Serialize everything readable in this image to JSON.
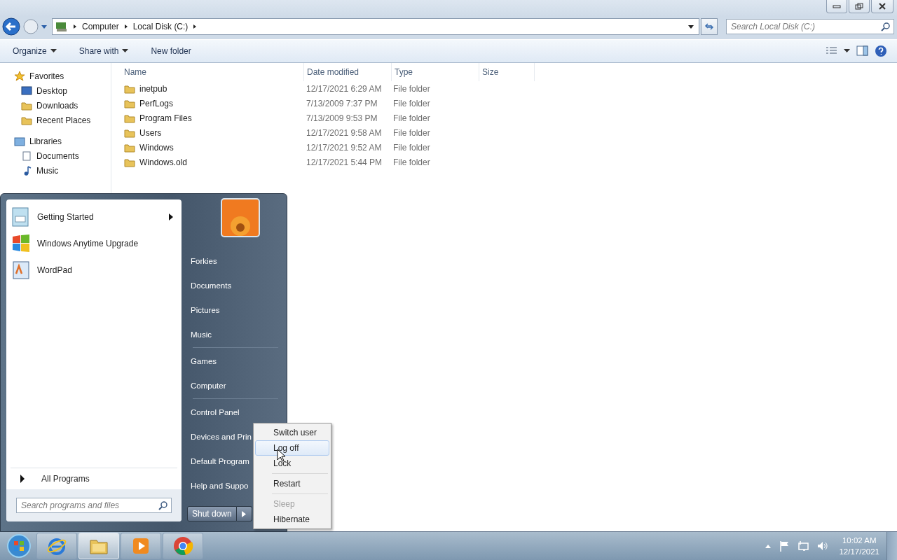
{
  "address": {
    "crumbs": [
      "Computer",
      "Local Disk (C:)"
    ]
  },
  "search": {
    "placeholder": "Search Local Disk (C:)"
  },
  "toolbar": [
    {
      "label": "Organize",
      "dropdown": true
    },
    {
      "label": "Share with",
      "dropdown": true
    },
    {
      "label": "New folder",
      "dropdown": false
    }
  ],
  "sidebar": [
    {
      "label": "Favorites",
      "kind": "star",
      "children": [
        {
          "label": "Desktop",
          "kind": "desktop"
        },
        {
          "label": "Downloads",
          "kind": "folder"
        },
        {
          "label": "Recent Places",
          "kind": "folder"
        }
      ]
    },
    {
      "label": "Libraries",
      "kind": "library",
      "children": [
        {
          "label": "Documents",
          "kind": "doc"
        },
        {
          "label": "Music",
          "kind": "music"
        }
      ]
    }
  ],
  "columns": [
    "Name",
    "Date modified",
    "Type",
    "Size"
  ],
  "rows": [
    {
      "name": "inetpub",
      "date": "12/17/2021 6:29 AM",
      "type": "File folder"
    },
    {
      "name": "PerfLogs",
      "date": "7/13/2009 7:37 PM",
      "type": "File folder"
    },
    {
      "name": "Program Files",
      "date": "7/13/2009 9:53 PM",
      "type": "File folder"
    },
    {
      "name": "Users",
      "date": "12/17/2021 9:58 AM",
      "type": "File folder"
    },
    {
      "name": "Windows",
      "date": "12/17/2021 9:52 AM",
      "type": "File folder"
    },
    {
      "name": "Windows.old",
      "date": "12/17/2021 5:44 PM",
      "type": "File folder"
    }
  ],
  "start_menu": {
    "programs": [
      {
        "label": "Getting Started",
        "kind": "getting-started",
        "submenu": true
      },
      {
        "label": "Windows Anytime Upgrade",
        "kind": "upgrade",
        "submenu": false
      },
      {
        "label": "WordPad",
        "kind": "wordpad",
        "submenu": false
      }
    ],
    "all_programs": "All Programs",
    "search": {
      "placeholder": "Search programs and files"
    },
    "links": [
      {
        "label": "Forkies",
        "divider_before": false
      },
      {
        "label": "Documents",
        "divider_before": false
      },
      {
        "label": "Pictures",
        "divider_before": false
      },
      {
        "label": "Music",
        "divider_before": false
      },
      {
        "label": "Games",
        "divider_before": true
      },
      {
        "label": "Computer",
        "divider_before": false
      },
      {
        "label": "Control Panel",
        "divider_before": true
      },
      {
        "label": "Devices and Prin",
        "divider_before": false
      },
      {
        "label": "Default Program",
        "divider_before": false
      },
      {
        "label": "Help and Suppo",
        "divider_before": false
      }
    ],
    "shutdown": "Shut down"
  },
  "power_menu": [
    {
      "label": "Switch user",
      "selected": false,
      "disabled": false,
      "divider_before": false
    },
    {
      "label": "Log off",
      "selected": true,
      "disabled": false,
      "divider_before": false
    },
    {
      "label": "Lock",
      "selected": false,
      "disabled": false,
      "divider_before": false
    },
    {
      "label": "Restart",
      "selected": false,
      "disabled": false,
      "divider_before": true
    },
    {
      "label": "Sleep",
      "selected": false,
      "disabled": true,
      "divider_before": true
    },
    {
      "label": "Hibernate",
      "selected": false,
      "disabled": false,
      "divider_before": false
    }
  ],
  "taskbar": {
    "apps": [
      {
        "kind": "ie",
        "selected": false
      },
      {
        "kind": "explorer",
        "selected": true
      },
      {
        "kind": "media",
        "selected": false
      },
      {
        "kind": "chrome",
        "selected": false
      }
    ],
    "time": "10:02 AM",
    "date": "12/17/2021"
  }
}
